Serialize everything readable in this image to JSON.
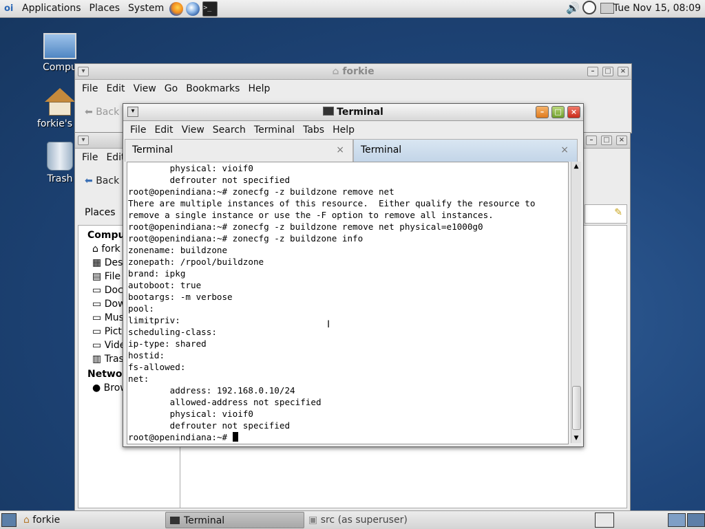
{
  "top_panel": {
    "menus": [
      "Applications",
      "Places",
      "System"
    ],
    "clock": "Tue Nov 15, 08:09"
  },
  "desktop": {
    "icons": [
      {
        "label": "Compu"
      },
      {
        "label": "forkie's H"
      },
      {
        "label": "Trash"
      }
    ]
  },
  "file_window": {
    "title": "forkie",
    "menus": [
      "File",
      "Edit",
      "View",
      "Go",
      "Bookmarks",
      "Help"
    ],
    "back_label": "Back"
  },
  "file_window2": {
    "menus": [
      "File",
      "Edit"
    ],
    "back_label": "Back",
    "places_label": "Places",
    "sidebar": {
      "computer_header": "Compu",
      "items": [
        "fork",
        "Desk",
        "File",
        "Docu",
        "Dow",
        "Musi",
        "Pictu",
        "Vide",
        "Tras"
      ],
      "network_header": "Netwo",
      "network_items": [
        "Brow"
      ]
    }
  },
  "terminal": {
    "title": "Terminal",
    "menus": [
      "File",
      "Edit",
      "View",
      "Search",
      "Terminal",
      "Tabs",
      "Help"
    ],
    "tabs": [
      {
        "label": "Terminal",
        "close": "×"
      },
      {
        "label": "Terminal",
        "close": "×"
      }
    ],
    "text": "        physical: vioif0\n        defrouter not specified\nroot@openindiana:~# zonecfg -z buildzone remove net\nThere are multiple instances of this resource.  Either qualify the resource to\nremove a single instance or use the -F option to remove all instances.\nroot@openindiana:~# zonecfg -z buildzone remove net physical=e1000g0\nroot@openindiana:~# zonecfg -z buildzone info\nzonename: buildzone\nzonepath: /rpool/buildzone\nbrand: ipkg\nautoboot: true\nbootargs: -m verbose\npool:\nlimitpriv:\nscheduling-class:\nip-type: shared\nhostid:\nfs-allowed:\nnet:\n        address: 192.168.0.10/24\n        allowed-address not specified\n        physical: vioif0\n        defrouter not specified\nroot@openindiana:~# "
  },
  "taskbar": {
    "tasks": [
      {
        "label": "forkie"
      },
      {
        "label": "Terminal"
      },
      {
        "label": "src (as superuser)"
      }
    ]
  }
}
